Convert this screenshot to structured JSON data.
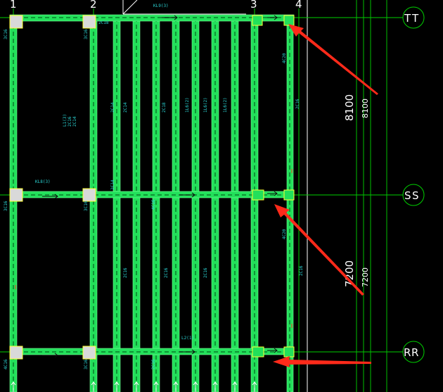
{
  "colors": {
    "background": "#000000",
    "beam": "#22e05a",
    "beam_edge": "#7bff9a",
    "dashed_center": "#0a7a2a",
    "grid_line": "#00d000",
    "column": "#d9d9d9",
    "column_edge": "#ffff33",
    "annotation": "#2bd4d4",
    "arrow": "#ff2a1a",
    "text": "#ffffff"
  },
  "axes": {
    "vertical": [
      {
        "label": "1"
      },
      {
        "label": "2"
      },
      {
        "label": "3"
      },
      {
        "label": "4"
      }
    ],
    "horizontal": [
      {
        "label": "T"
      },
      {
        "label": "S"
      },
      {
        "label": "R"
      }
    ]
  },
  "dimensions": [
    {
      "primary": "8100",
      "secondary": "8100"
    },
    {
      "primary": "7200",
      "secondary": "7200"
    }
  ],
  "annotations": [
    "KL9(3)",
    "2C18",
    "2C14",
    "2C16",
    "3C16",
    "L1(3)",
    "4C16",
    "4C20",
    "1L6(2)",
    "KL8(3)",
    "L2(1)"
  ]
}
